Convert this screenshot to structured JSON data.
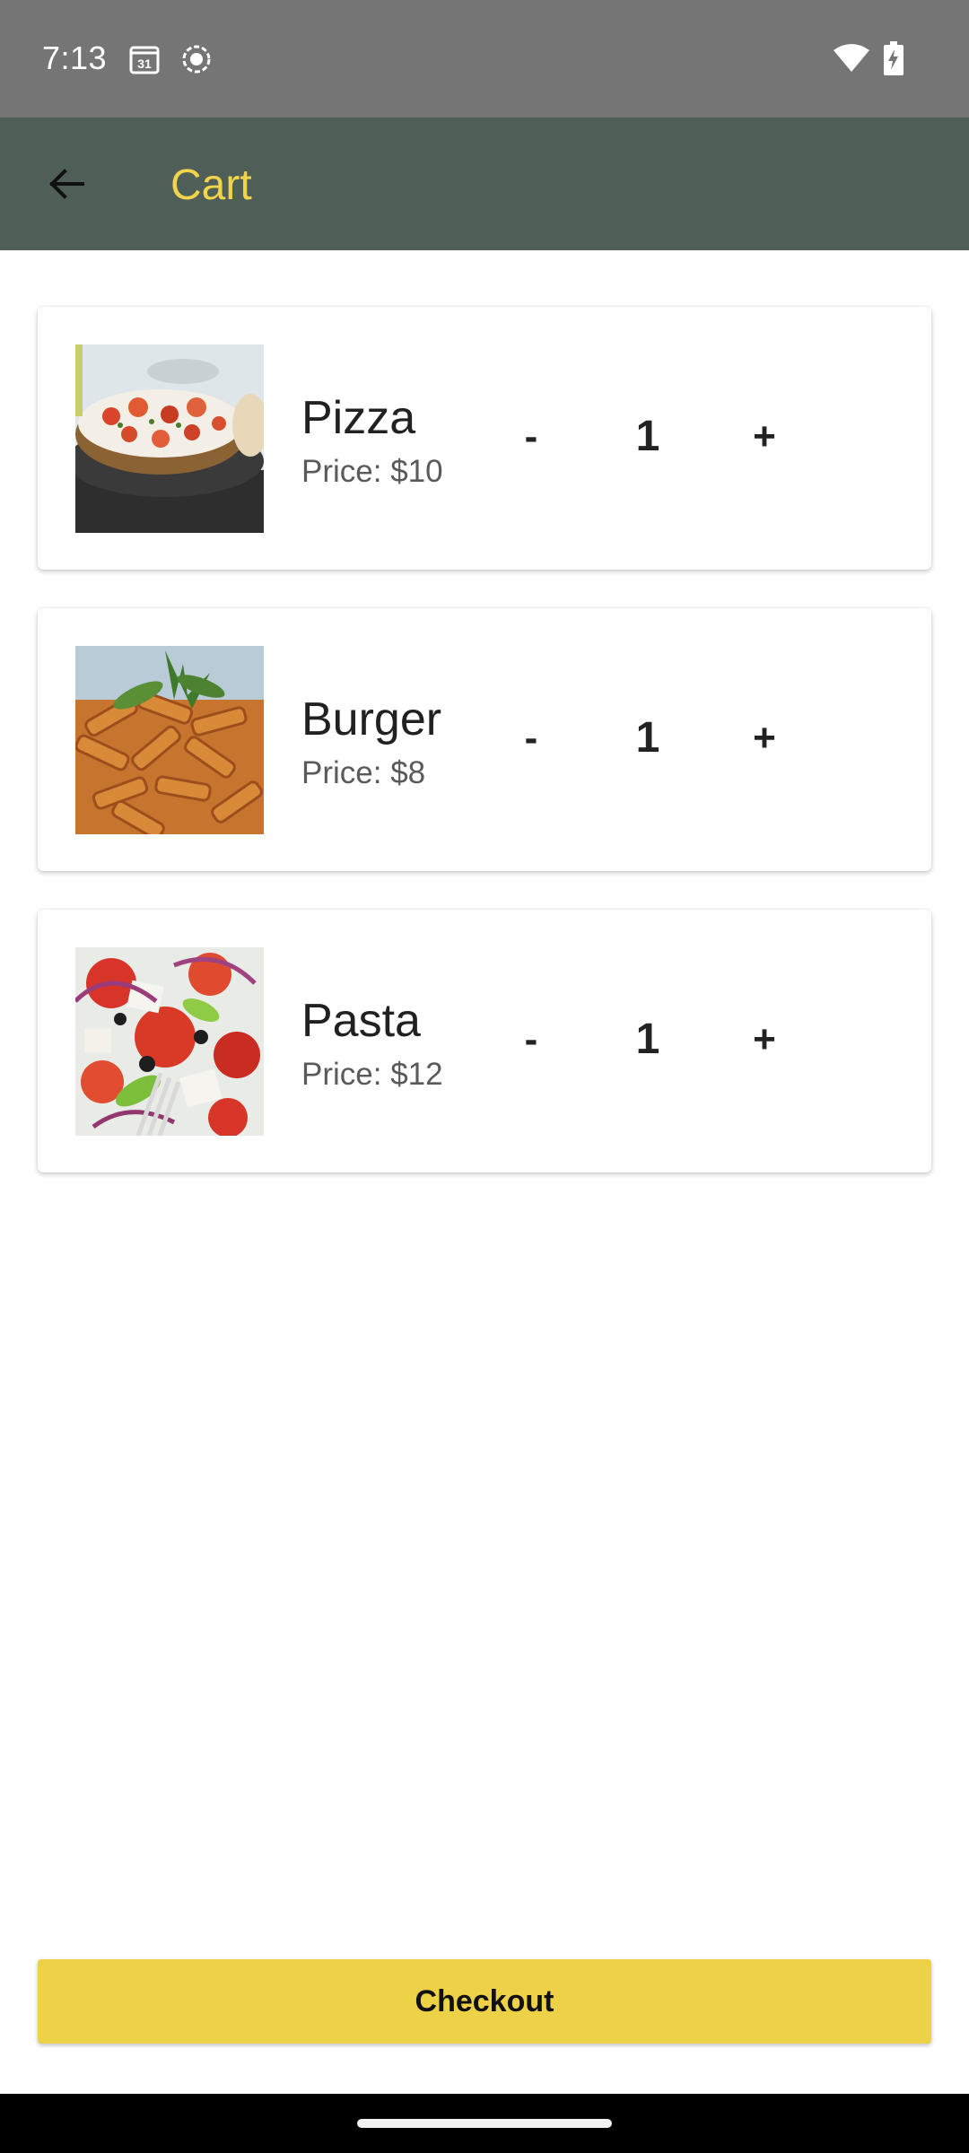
{
  "status_bar": {
    "time": "7:13",
    "calendar_day": "31",
    "icons": [
      "calendar-icon",
      "screen-record-icon",
      "wifi-icon",
      "battery-charging-icon"
    ]
  },
  "app_bar": {
    "title": "Cart",
    "back_icon": "arrow-left-icon",
    "background": "#4f5f58",
    "title_color": "#f2d44a"
  },
  "cart": {
    "items": [
      {
        "name": "Pizza",
        "price": "Price: $10",
        "quantity": "1",
        "minus": "-",
        "plus": "+"
      },
      {
        "name": "Burger",
        "price": "Price: $8",
        "quantity": "1",
        "minus": "-",
        "plus": "+"
      },
      {
        "name": "Pasta",
        "price": "Price: $12",
        "quantity": "1",
        "minus": "-",
        "plus": "+"
      }
    ]
  },
  "checkout": {
    "label": "Checkout",
    "color": "#edd147"
  }
}
